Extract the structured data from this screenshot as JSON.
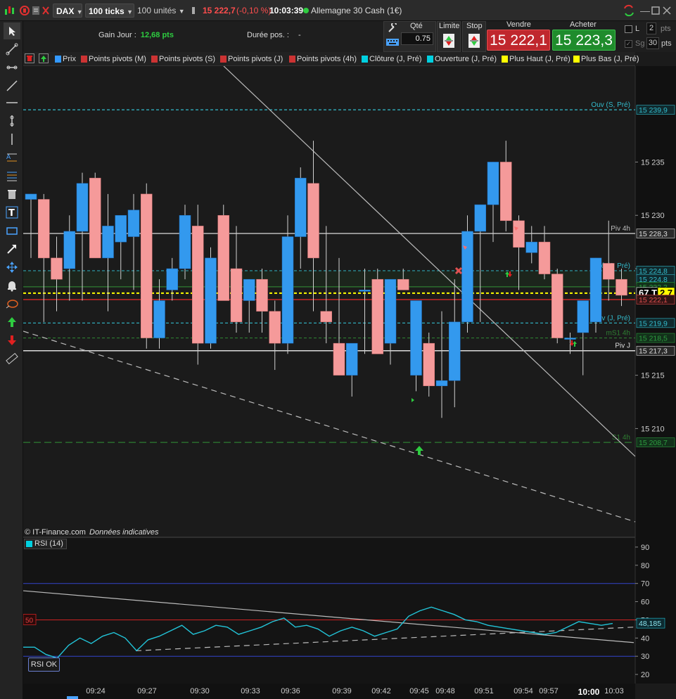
{
  "topbar": {
    "symbol": "DAX",
    "period": "100 ticks",
    "units": "100 unités",
    "last_price": "15 222,7",
    "change": "(-0,10 %)",
    "time": "10:03:39",
    "instrument": "Allemagne 30 Cash (1€)"
  },
  "infobar": {
    "gain_label": "Gain Jour :",
    "gain_value": "12,68 pts",
    "duration_label": "Durée pos. :",
    "duration_value": "-",
    "qty_label": "Qté",
    "qty_value": "0.75",
    "limit_label": "Limite",
    "stop_label": "Stop",
    "sell_label": "Vendre",
    "sell_price": "15 222,1",
    "buy_label": "Acheter",
    "buy_price": "15 223,3",
    "l_label": "L",
    "l_value": "2",
    "l_unit": "pts",
    "sg_label": "Sg",
    "sg_value": "30",
    "sg_unit": "pts"
  },
  "indicators": [
    {
      "label": "Prix",
      "color": "#3399ff"
    },
    {
      "label": "Points pivots (M)",
      "color": "#cc3333"
    },
    {
      "label": "Points pivots (S)",
      "color": "#cc3333"
    },
    {
      "label": "Points pivots (J)",
      "color": "#cc3333"
    },
    {
      "label": "Points pivots (4h)",
      "color": "#cc3333"
    },
    {
      "label": "Clôture (J, Pré)",
      "color": "#00d0e0"
    },
    {
      "label": "Ouverture (J, Pré)",
      "color": "#00d0e0"
    },
    {
      "label": "Plus Haut (J, Pré)",
      "color": "#ffff00"
    },
    {
      "label": "Plus Bas (J, Pré)",
      "color": "#ffff00"
    }
  ],
  "chart_data": {
    "type": "candlestick",
    "yrange": [
      15200,
      15244
    ],
    "y_ticks": [
      "15 235",
      "15 230",
      "15 225",
      "15 215",
      "15 210"
    ],
    "x_labels": [
      "09:24",
      "09:27",
      "09:30",
      "09:33",
      "09:36",
      "09:39",
      "09:42",
      "09:45",
      "09:48",
      "09:51",
      "09:54",
      "09:57",
      "10:00",
      "10:03"
    ],
    "candles": [
      {
        "o": 15231.5,
        "h": 15232.0,
        "l": 15226.0,
        "c": 15232.0
      },
      {
        "o": 15231.5,
        "h": 15232.0,
        "l": 15220.0,
        "c": 15226.0
      },
      {
        "o": 15226.0,
        "h": 15228.0,
        "l": 15221.0,
        "c": 15224.0
      },
      {
        "o": 15225.0,
        "h": 15230.0,
        "l": 15222.0,
        "c": 15228.5
      },
      {
        "o": 15228.5,
        "h": 15234.0,
        "l": 15222.0,
        "c": 15233.0
      },
      {
        "o": 15233.5,
        "h": 15234.0,
        "l": 15226.0,
        "c": 15226.0
      },
      {
        "o": 15226.0,
        "h": 15232.0,
        "l": 15221.0,
        "c": 15229.0
      },
      {
        "o": 15227.5,
        "h": 15230.0,
        "l": 15224.0,
        "c": 15230.0
      },
      {
        "o": 15228.0,
        "h": 15232.0,
        "l": 15223.0,
        "c": 15230.5
      },
      {
        "o": 15232.0,
        "h": 15233.0,
        "l": 15217.5,
        "c": 15218.5
      },
      {
        "o": 15218.5,
        "h": 15224.0,
        "l": 15217.5,
        "c": 15222.0
      },
      {
        "o": 15223.0,
        "h": 15226.0,
        "l": 15222.0,
        "c": 15225.0
      },
      {
        "o": 15225.0,
        "h": 15231.0,
        "l": 15224.0,
        "c": 15230.0
      },
      {
        "o": 15229.0,
        "h": 15231.0,
        "l": 15216.0,
        "c": 15218.0
      },
      {
        "o": 15218.0,
        "h": 15227.0,
        "l": 15217.5,
        "c": 15226.0
      },
      {
        "o": 15230.0,
        "h": 15231.0,
        "l": 15222.0,
        "c": 15222.0
      },
      {
        "o": 15225.0,
        "h": 15229.0,
        "l": 15219.0,
        "c": 15220.0
      },
      {
        "o": 15222.0,
        "h": 15224.0,
        "l": 15219.0,
        "c": 15224.0
      },
      {
        "o": 15224.0,
        "h": 15225.0,
        "l": 15219.0,
        "c": 15221.0
      },
      {
        "o": 15221.0,
        "h": 15222.0,
        "l": 15215.5,
        "c": 15218.0
      },
      {
        "o": 15218.0,
        "h": 15230.0,
        "l": 15217.0,
        "c": 15228.0
      },
      {
        "o": 15228.0,
        "h": 15234.5,
        "l": 15225.0,
        "c": 15233.5
      },
      {
        "o": 15233.0,
        "h": 15237.0,
        "l": 15221.0,
        "c": 15226.0
      },
      {
        "o": 15221.0,
        "h": 15229.0,
        "l": 15218.0,
        "c": 15220.0
      },
      {
        "o": 15218.0,
        "h": 15226.0,
        "l": 15215.0,
        "c": 15215.0
      },
      {
        "o": 15215.0,
        "h": 15216.0,
        "l": 15213.0,
        "c": 15218.0
      },
      {
        "o": 15223.0,
        "h": 15225.0,
        "l": 15217.0,
        "c": 15223.0
      },
      {
        "o": 15224.0,
        "h": 15225.0,
        "l": 15217.0,
        "c": 15217.0
      },
      {
        "o": 15218.0,
        "h": 15224.0,
        "l": 15216.0,
        "c": 15224.0
      },
      {
        "o": 15224.0,
        "h": 15225.0,
        "l": 15223.0,
        "c": 15223.0
      },
      {
        "o": 15215.0,
        "h": 15219.0,
        "l": 15213.5,
        "c": 15222.0
      },
      {
        "o": 15218.0,
        "h": 15219.0,
        "l": 15213.0,
        "c": 15214.0
      },
      {
        "o": 15214.0,
        "h": 15221.0,
        "l": 15211.0,
        "c": 15214.5
      },
      {
        "o": 15214.5,
        "h": 15224.0,
        "l": 15212.0,
        "c": 15220.0
      },
      {
        "o": 15220.0,
        "h": 15230.0,
        "l": 15219.0,
        "c": 15228.5
      },
      {
        "o": 15228.5,
        "h": 15231.0,
        "l": 15220.0,
        "c": 15231.0
      },
      {
        "o": 15231.0,
        "h": 15235.0,
        "l": 15227.5,
        "c": 15235.0
      },
      {
        "o": 15235.0,
        "h": 15237.0,
        "l": 15228.5,
        "c": 15229.5
      },
      {
        "o": 15229.5,
        "h": 15230.0,
        "l": 15223.0,
        "c": 15227.0
      },
      {
        "o": 15226.5,
        "h": 15229.0,
        "l": 15225.5,
        "c": 15227.5
      },
      {
        "o": 15227.5,
        "h": 15229.0,
        "l": 15224.0,
        "c": 15224.5
      },
      {
        "o": 15224.5,
        "h": 15225.0,
        "l": 15218.0,
        "c": 15218.5
      },
      {
        "o": 15218.5,
        "h": 15219.0,
        "l": 15217.0,
        "c": 15218.5
      },
      {
        "o": 15219.0,
        "h": 15222.0,
        "l": 15215.0,
        "c": 15222.0
      },
      {
        "o": 15220.0,
        "h": 15226.0,
        "l": 15219.0,
        "c": 15226.0
      },
      {
        "o": 15225.5,
        "h": 15229.5,
        "l": 15222.0,
        "c": 15224.0
      },
      {
        "o": 15224.0,
        "h": 15225.0,
        "l": 15221.5,
        "c": 15222.5
      }
    ],
    "levels": [
      {
        "label": "Ouv (S, Pré)",
        "value": 15239.9,
        "color": "#33bbcc",
        "style": "dashed"
      },
      {
        "label": "Piv 4h",
        "value": 15228.3,
        "color": "#bbbbbb",
        "style": "solid"
      },
      {
        "label": "Clô (J, Pré)",
        "value": 15224.8,
        "color": "#33bbcc",
        "style": "dashed"
      },
      {
        "label": "",
        "value": 15223.3,
        "color": "#2e7d32",
        "style": "solid"
      },
      {
        "label": "",
        "value": 15222.7,
        "color": "#ffff00",
        "style": "dashed"
      },
      {
        "label": "",
        "value": 15222.1,
        "color": "#c62828",
        "style": "solid"
      },
      {
        "label": "Ouv (J, Pré)",
        "value": 15219.9,
        "color": "#33bbcc",
        "style": "dashed"
      },
      {
        "label": "mS1 4h",
        "value": 15218.5,
        "color": "#2e7d32",
        "style": "dashed"
      },
      {
        "label": "Piv J",
        "value": 15217.3,
        "color": "#dddddd",
        "style": "solid"
      },
      {
        "label": "S1 4h",
        "value": 15208.7,
        "color": "#2e7d32",
        "style": "dashed"
      }
    ],
    "price_badges": [
      {
        "text": "15 239,9",
        "value": 15239.9,
        "color": "#33bbcc",
        "bg": "#102a2e"
      },
      {
        "text": "15 228,3",
        "value": 15228.3,
        "color": "#dddddd",
        "bg": "#2a2a2a"
      },
      {
        "text": "15 224,8",
        "value": 15224.8,
        "color": "#33bbcc",
        "bg": "#102a2e"
      },
      {
        "text": "15 224,8",
        "value": 15224.0,
        "color": "#33bbcc",
        "bg": "#102a2e"
      },
      {
        "text": "15 223,3",
        "value": 15223.3,
        "color": "#2e9d40",
        "bg": "#12301a"
      },
      {
        "text": "67 T",
        "value": 15222.7,
        "color": "#ffffff",
        "bg": "#000000"
      },
      {
        "text": "2,7",
        "value": 15222.7,
        "color": "#000000",
        "bg": "#ffff00"
      },
      {
        "text": "15 222,1",
        "value": 15222.1,
        "color": "#e05050",
        "bg": "#301414"
      },
      {
        "text": "15 219,9",
        "value": 15219.9,
        "color": "#33bbcc",
        "bg": "#102a2e"
      },
      {
        "text": "15 218,5",
        "value": 15218.5,
        "color": "#2e9d40",
        "bg": "#12301a"
      },
      {
        "text": "15 217,3",
        "value": 15217.3,
        "color": "#dddddd",
        "bg": "#2a2a2a"
      },
      {
        "text": "15 208,7",
        "value": 15208.7,
        "color": "#2e9d40",
        "bg": "#12301a"
      }
    ],
    "copyright": "© IT-Finance.com",
    "disclaimer": "Données indicatives"
  },
  "rsi": {
    "label": "RSI (14)",
    "yrange": [
      15,
      95
    ],
    "y_ticks": [
      "90",
      "80",
      "70",
      "60",
      "50",
      "40",
      "30",
      "20"
    ],
    "level_hi": 70,
    "level_mid": 50,
    "level_lo": 30,
    "mid_tag": "50",
    "value_badge": "48,185",
    "status_button": "RSI OK",
    "values": [
      35,
      35,
      31,
      29,
      36,
      40,
      37,
      41,
      43,
      40,
      33,
      39,
      41,
      44,
      47,
      42,
      44,
      47,
      46,
      42,
      44,
      46,
      49,
      51,
      46,
      47,
      45,
      41,
      44,
      46,
      44,
      41,
      43,
      45,
      52,
      55,
      57,
      55,
      53,
      50,
      49,
      47,
      46,
      45,
      44,
      43,
      42,
      43,
      46,
      49,
      48,
      47,
      48
    ]
  },
  "colors": {
    "bull": "#3399ee",
    "bear": "#f59a9a",
    "up_arrow": "#2ecc40",
    "down_arrow": "#e02020"
  }
}
